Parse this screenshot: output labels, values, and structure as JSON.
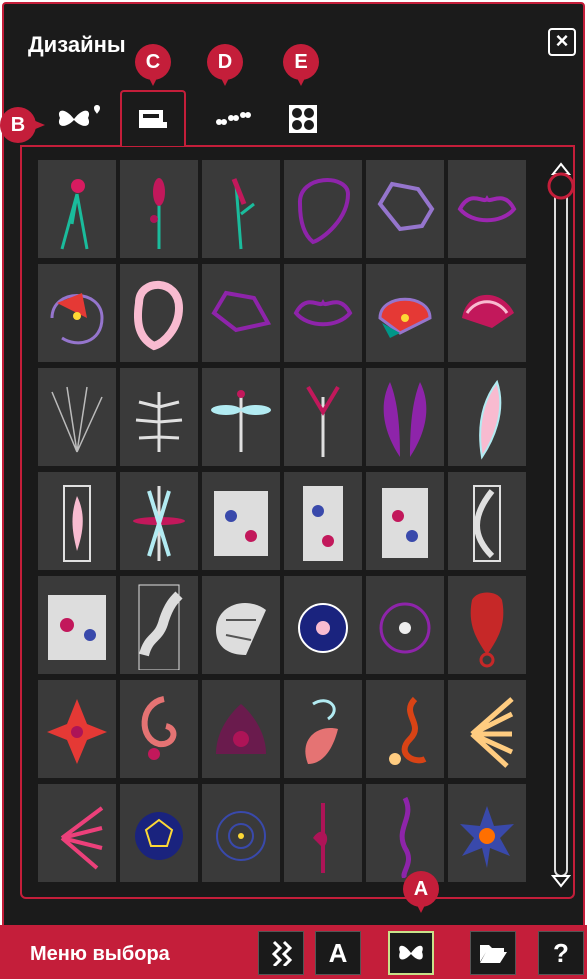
{
  "window": {
    "title": "Дизайны",
    "close_icon": "close-icon"
  },
  "badges": {
    "a": "A",
    "b": "B",
    "c": "C",
    "d": "D",
    "e": "E"
  },
  "tabs": [
    {
      "id": "favorites",
      "icon": "butterfly-heart-icon",
      "active": false
    },
    {
      "id": "machine-designs",
      "icon": "sewing-machine-icon",
      "active": true
    },
    {
      "id": "mini-designs",
      "icon": "small-butterflies-icon",
      "active": false
    },
    {
      "id": "quilt-designs",
      "icon": "quilt-block-icon",
      "active": false
    }
  ],
  "designs": {
    "rows": 7,
    "columns": 6,
    "icons": [
      "carnation-stem",
      "pink-flower-stem",
      "tulip-stem",
      "purple-outline-heart",
      "lavender-outline-cloud",
      "purple-outline-lips",
      "poppy-outline",
      "pink-thick-heart",
      "purple-outline-bean",
      "purple-outline-lips-2",
      "poppy-pinwheel",
      "pink-shell-fan",
      "fern-fan-outline",
      "white-fern-leaves",
      "dragonfly",
      "pink-stem-wing",
      "purple-feathers",
      "pink-feather",
      "bookmark-pink-feather",
      "dragonfly-vertical",
      "floral-panel-wide",
      "floral-panel-narrow",
      "floral-panel-square",
      "arc-border-frame",
      "floral-block",
      "floral-strip-tall",
      "white-paisley-cluster",
      "navy-daisy",
      "purple-outline-flower",
      "red-skull-ornament",
      "red-mandala",
      "paisley-swirl",
      "damask-crown",
      "teal-swirl-leaf",
      "red-dragon-swirl",
      "fan-of-leaves",
      "purple-leaf-fan",
      "gold-star-pentagon",
      "navy-concentric-circles",
      "berry-pendant",
      "purple-twist-pendant",
      "star-burst-flower"
    ]
  },
  "bottom_bar": {
    "label": "Меню выбора",
    "buttons": [
      {
        "id": "stitch",
        "icon": "stitch-icon"
      },
      {
        "id": "font",
        "label": "A"
      },
      {
        "id": "designs",
        "icon": "butterfly-icon",
        "active": true
      },
      {
        "id": "open",
        "icon": "folder-icon"
      },
      {
        "id": "help",
        "label": "?"
      }
    ]
  },
  "colors": {
    "accent": "#c41e3a",
    "panel": "#1b1b1b",
    "tile": "#3a3a3a"
  }
}
